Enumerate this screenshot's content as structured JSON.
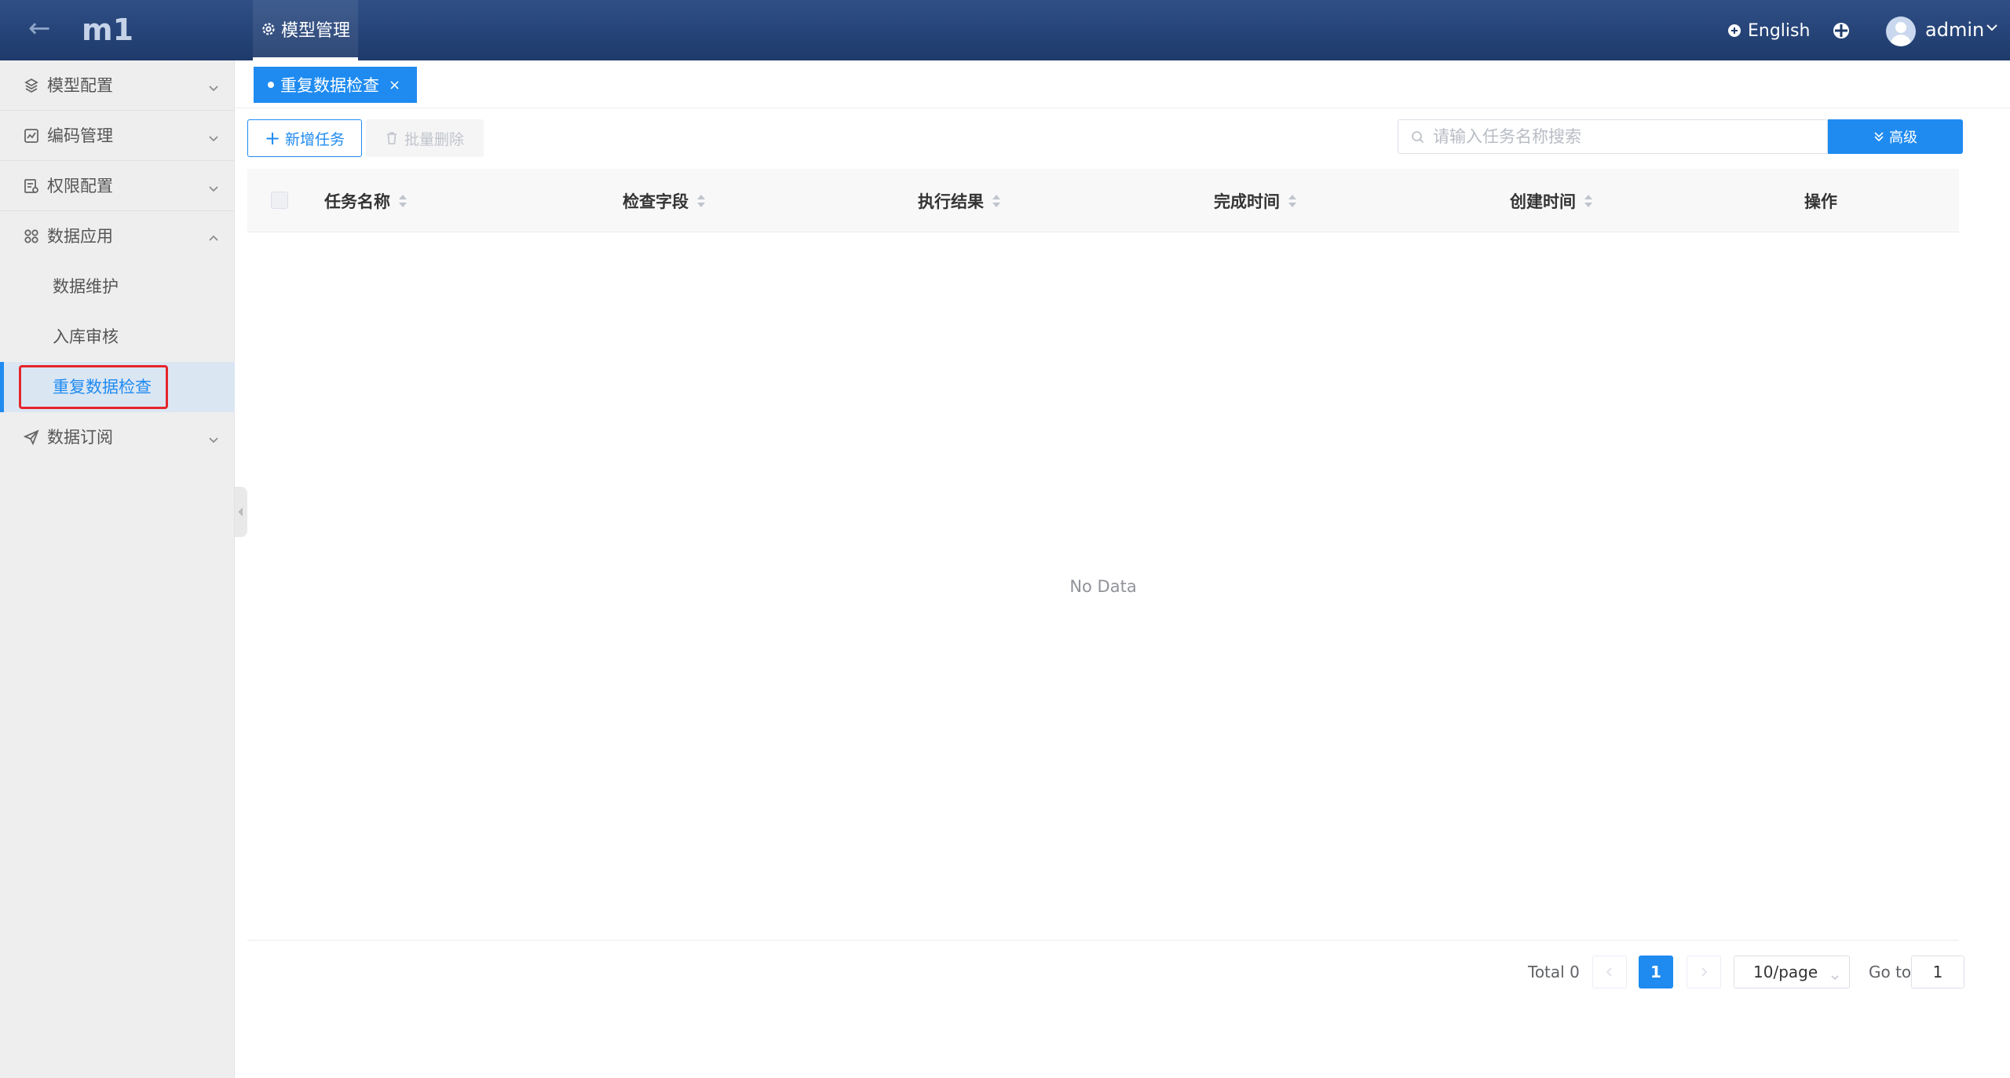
{
  "header": {
    "app_title": "m1",
    "top_tab_label": "模型管理",
    "language_label": "English",
    "user_name": "admin"
  },
  "sidebar": {
    "items": [
      {
        "label": "模型配置",
        "icon": "cube-stack-icon",
        "expanded": false
      },
      {
        "label": "编码管理",
        "icon": "code-chart-icon",
        "expanded": false
      },
      {
        "label": "权限配置",
        "icon": "permission-doc-icon",
        "expanded": false
      },
      {
        "label": "数据应用",
        "icon": "grid-apps-icon",
        "expanded": true
      },
      {
        "label": "数据订阅",
        "icon": "send-icon",
        "expanded": false
      }
    ],
    "subitems": [
      {
        "label": "数据维护",
        "active": false
      },
      {
        "label": "入库审核",
        "active": false
      },
      {
        "label": "重复数据检查",
        "active": true
      }
    ]
  },
  "tags": {
    "active_tag_label": "重复数据检查"
  },
  "toolbar": {
    "add_label": "新增任务",
    "batch_delete_label": "批量删除",
    "search_placeholder": "请输入任务名称搜索",
    "advanced_label": "高级"
  },
  "table": {
    "columns": [
      "任务名称",
      "检查字段",
      "执行结果",
      "完成时间",
      "创建时间",
      "操作"
    ],
    "rows": [],
    "empty_text": "No Data"
  },
  "pagination": {
    "total_text": "Total 0",
    "current_page": "1",
    "page_size": "10/page",
    "goto_label": "Go to",
    "goto_value": "1"
  },
  "colors": {
    "header_bg": "#1e3a6b",
    "accent": "#1f8bf0",
    "highlight": "#e5262b"
  }
}
